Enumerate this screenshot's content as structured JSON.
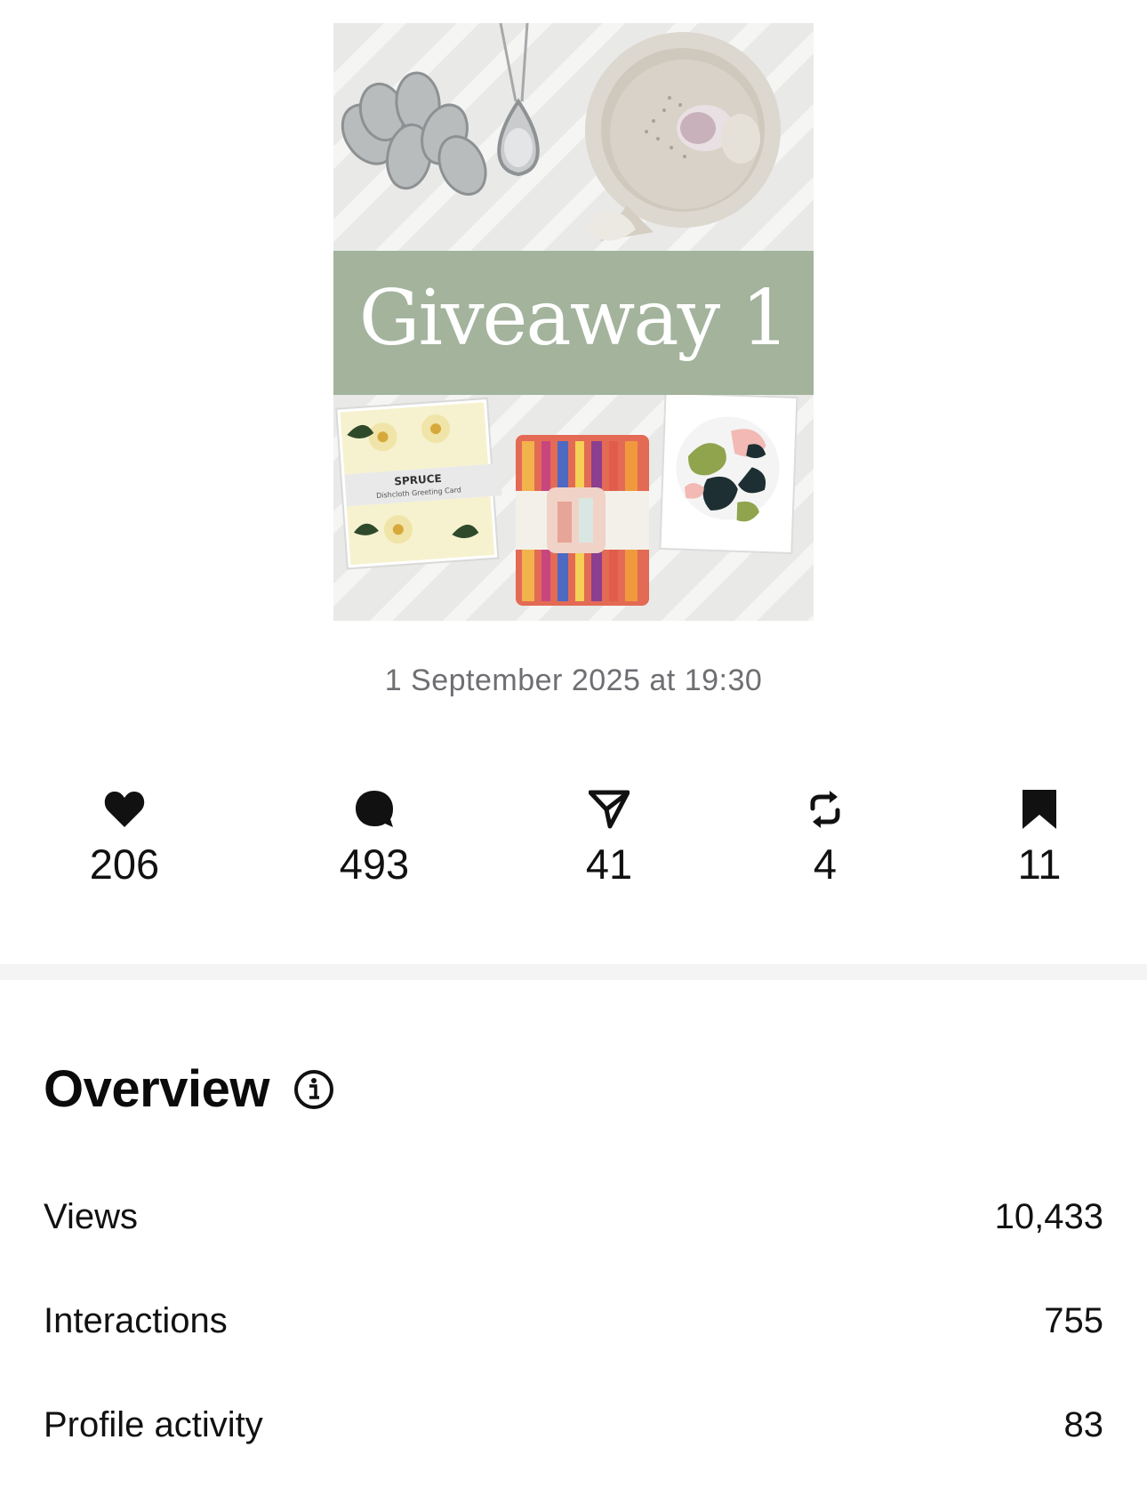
{
  "post": {
    "image": {
      "title": "Giveaway 1",
      "card_brand": "SPRUCE",
      "card_subtitle": "Dishcloth Greeting Card"
    },
    "timestamp": "1 September 2025 at 19:30"
  },
  "stats": [
    {
      "icon": "heart-icon",
      "count": "206"
    },
    {
      "icon": "comment-icon",
      "count": "493"
    },
    {
      "icon": "share-icon",
      "count": "41"
    },
    {
      "icon": "repost-icon",
      "count": "4"
    },
    {
      "icon": "bookmark-icon",
      "count": "11"
    }
  ],
  "overview": {
    "title": "Overview",
    "info_icon": "info-icon",
    "metrics": [
      {
        "label": "Views",
        "value": "10,433"
      },
      {
        "label": "Interactions",
        "value": "755"
      },
      {
        "label": "Profile activity",
        "value": "83"
      }
    ]
  },
  "colors": {
    "band_green": "#a3b39c",
    "timestamp_gray": "#6e6e73",
    "divider": "#f4f4f5"
  }
}
